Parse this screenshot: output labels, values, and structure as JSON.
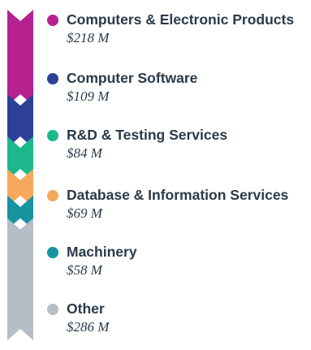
{
  "chart_data": {
    "type": "bar",
    "orientation": "stacked-vertical",
    "title": "",
    "xlabel": "",
    "ylabel": "",
    "unit": "$M",
    "categories": [
      "Computers & Electronic Products",
      "Computer Software",
      "R&D & Testing Services",
      "Database & Information Services",
      "Machinery",
      "Other"
    ],
    "values": [
      218,
      109,
      84,
      69,
      58,
      286
    ],
    "value_labels": [
      "$218 M",
      "$109 M",
      "$84 M",
      "$69 M",
      "$58 M",
      "$286 M"
    ],
    "colors": [
      "#b5228e",
      "#2e3f98",
      "#1cb88c",
      "#f6a85c",
      "#1893a0",
      "#b5bec6"
    ],
    "legend_position": "right"
  }
}
